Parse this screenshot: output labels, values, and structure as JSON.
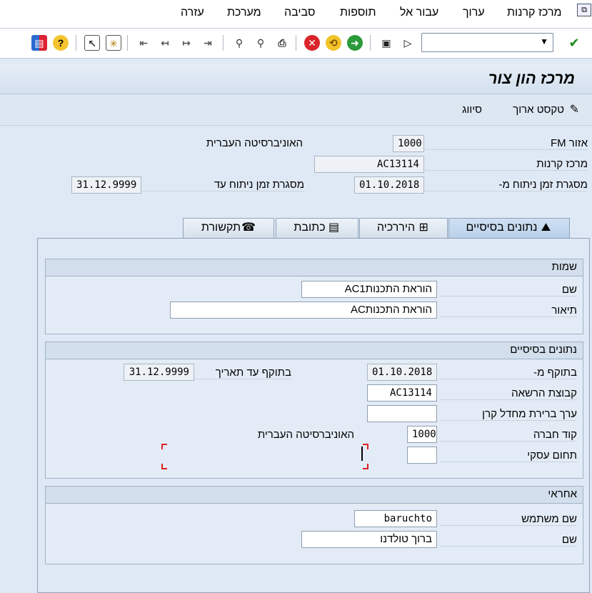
{
  "menu": {
    "items": [
      "מרכז קרנות",
      "ערוך",
      "עבור אל",
      "תוספות",
      "סביבה",
      "מערכת",
      "עזרה"
    ]
  },
  "toolbar": {
    "command_value": ""
  },
  "title": "מרכז הון צור",
  "app_toolbar": {
    "long_text": "טקסט ארוך",
    "classification": "סיווג"
  },
  "header": {
    "fm_area_label": "אזור FM",
    "fm_area_value": "1000",
    "fm_area_desc": "האוניברסיטה העברית",
    "fund_center_label": "מרכז קרנות",
    "fund_center_value": "AC13114",
    "time_from_label": "מסגרת זמן ניתוח מ-",
    "time_from_value": "01.10.2018",
    "time_to_label": "מסגרת זמן ניתוח עד",
    "time_to_value": "31.12.9999"
  },
  "tabs": [
    "נתונים בסיסיים",
    "היררכיה",
    "כתובת",
    "תקשורת"
  ],
  "names_group": {
    "title": "שמות",
    "name_label": "שם",
    "name_value": "הוראת התכנותAC1",
    "desc_label": "תיאור",
    "desc_value": "הוראת התכנותAC"
  },
  "basic_group": {
    "title": "נתונים בסיסיים",
    "valid_from_label": "בתוקף מ-",
    "valid_from_value": "01.10.2018",
    "valid_to_label": "בתוקף עד תאריך",
    "valid_to_value": "31.12.9999",
    "auth_group_label": "קבוצת הרשאה",
    "auth_group_value": "AC13114",
    "default_label": "ערך ברירת מחדל קרן",
    "default_value": "",
    "company_label": "קוד חברה",
    "company_value": "1000",
    "company_desc": "האוניברסיטה העברית",
    "business_label": "תחום עסקי",
    "business_value": ""
  },
  "responsible_group": {
    "title": "אחראי",
    "user_label": "שם משתמש",
    "user_value": "baruchto",
    "name_label": "שם",
    "name_value": "ברוך טולדנו"
  }
}
